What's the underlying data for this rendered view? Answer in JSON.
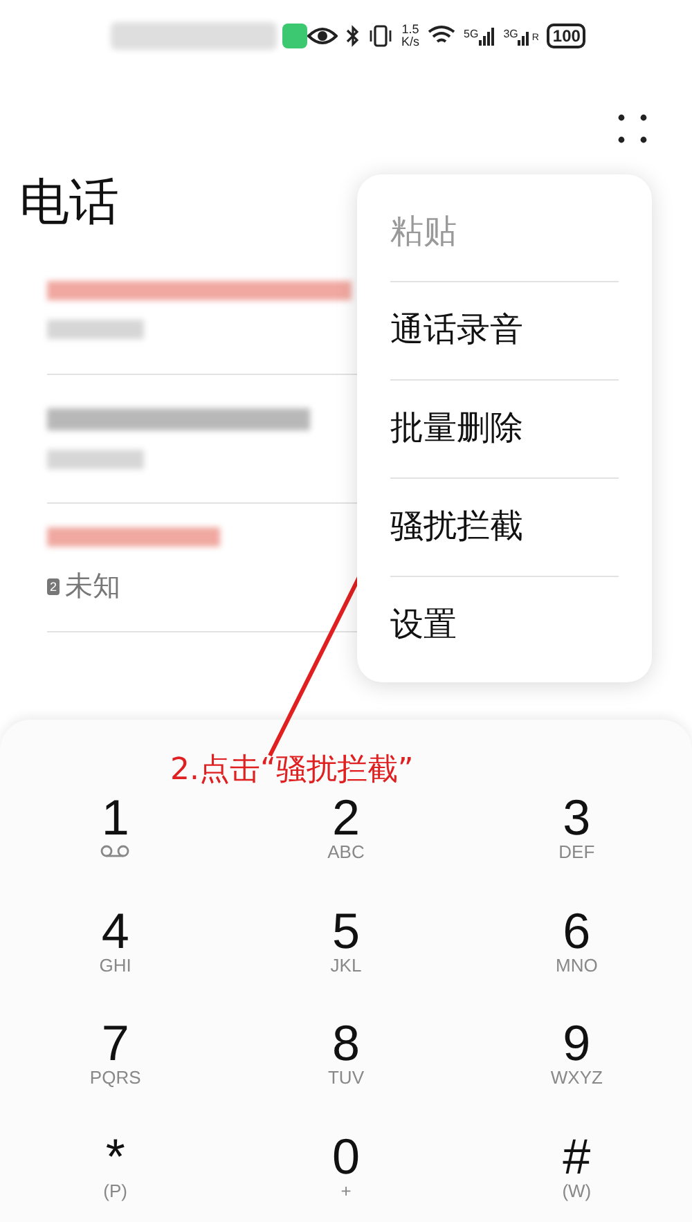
{
  "status_bar": {
    "speed_value": "1.5",
    "speed_unit": "K/s",
    "network_1": "5G",
    "network_2": "3G",
    "roaming": "R",
    "battery": "100"
  },
  "title": "电话",
  "calls": [
    {
      "kind": "redacted"
    },
    {
      "kind": "redacted"
    },
    {
      "kind": "partial",
      "subtitle": "未知",
      "sim": "2"
    }
  ],
  "menu": [
    {
      "label": "粘贴",
      "disabled": true
    },
    {
      "label": "通话录音",
      "disabled": false
    },
    {
      "label": "批量删除",
      "disabled": false
    },
    {
      "label": "骚扰拦截",
      "disabled": false
    },
    {
      "label": "设置",
      "disabled": false
    }
  ],
  "annotation": "2.点击“骚扰拦截”",
  "keypad": [
    {
      "digit": "1",
      "kind": "voicemail"
    },
    {
      "digit": "2",
      "sub": "ABC",
      "kind": "text"
    },
    {
      "digit": "3",
      "sub": "DEF",
      "kind": "text"
    },
    {
      "digit": "4",
      "sub": "GHI",
      "kind": "text"
    },
    {
      "digit": "5",
      "sub": "JKL",
      "kind": "text"
    },
    {
      "digit": "6",
      "sub": "MNO",
      "kind": "text"
    },
    {
      "digit": "7",
      "sub": "PQRS",
      "kind": "text"
    },
    {
      "digit": "8",
      "sub": "TUV",
      "kind": "text"
    },
    {
      "digit": "9",
      "sub": "WXYZ",
      "kind": "text"
    },
    {
      "digit": "*",
      "sub": "(P)",
      "kind": "text"
    },
    {
      "digit": "0",
      "sub": "+",
      "kind": "text"
    },
    {
      "digit": "#",
      "sub": "(W)",
      "kind": "text"
    }
  ]
}
